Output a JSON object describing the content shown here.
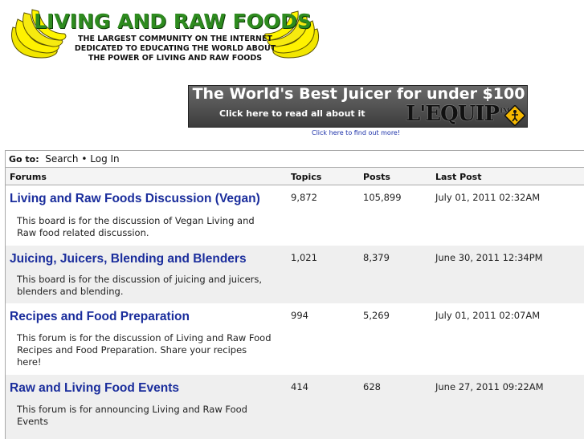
{
  "header": {
    "site_title": "LIVING AND RAW FOODS",
    "tagline_1": "THE LARGEST COMMUNITY ON THE INTERNET",
    "tagline_2": "DEDICATED TO EDUCATING THE WORLD ABOUT",
    "tagline_3": "THE POWER OF LIVING AND RAW FOODS",
    "icon": "banana-bunch-icon"
  },
  "banner": {
    "headline": "The World's Best Juicer for under $100",
    "subline": "Click here to read all about it",
    "brand": "L'EQUIP",
    "tm": "TM",
    "link_text": "Click here to find out more!",
    "icon": "person-warning-sign-icon"
  },
  "nav": {
    "goto_label": "Go to:",
    "search": "Search",
    "separator": "•",
    "login": "Log In"
  },
  "columns": {
    "forums": "Forums",
    "topics": "Topics",
    "posts": "Posts",
    "last_post": "Last Post"
  },
  "forums": [
    {
      "title": "Living and Raw Foods Discussion (Vegan)",
      "desc_lines": [
        "This board is for the discussion of Vegan Living and",
        "Raw food related discussion."
      ],
      "topics": "9,872",
      "posts": "105,899",
      "last_post": "July 01, 2011 02:32AM"
    },
    {
      "title": "Juicing, Juicers, Blending and Blenders",
      "desc_lines": [
        "This board is for the discussion of juicing and juicers,",
        "blenders and blending."
      ],
      "topics": "1,021",
      "posts": "8,379",
      "last_post": "June 30, 2011 12:34PM"
    },
    {
      "title": "Recipes and Food Preparation",
      "desc_lines": [
        "This forum is for the discussion of Living and Raw Food",
        "Recipes and Food Preparation. Share your recipes",
        "here!"
      ],
      "topics": "994",
      "posts": "5,269",
      "last_post": "July 01, 2011 02:07AM"
    },
    {
      "title": "Raw and Living Food Events",
      "desc_lines": [
        "This forum is for announcing Living and Raw Food",
        "Events"
      ],
      "topics": "414",
      "posts": "628",
      "last_post": "June 27, 2011 09:22AM"
    }
  ],
  "colors": {
    "title_green": "#2e8b1f",
    "forum_link": "#1a2d9c",
    "alt_row": "#efefef"
  }
}
